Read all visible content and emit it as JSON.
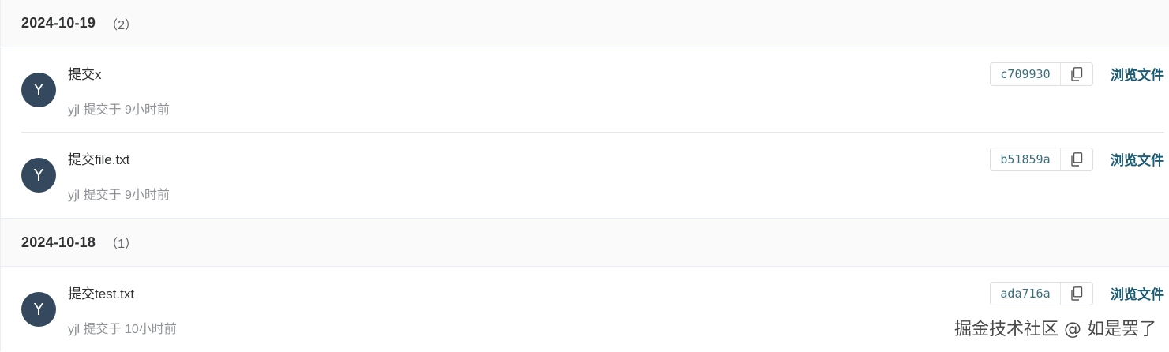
{
  "groups": [
    {
      "date": "2024-10-19",
      "count": "（2）",
      "commits": [
        {
          "avatar": "Y",
          "title": "提交x",
          "meta": "yjl 提交于 9小时前",
          "sha": "c709930",
          "browse": "浏览文件"
        },
        {
          "avatar": "Y",
          "title": "提交file.txt",
          "meta": "yjl 提交于 9小时前",
          "sha": "b51859a",
          "browse": "浏览文件"
        }
      ]
    },
    {
      "date": "2024-10-18",
      "count": "（1）",
      "commits": [
        {
          "avatar": "Y",
          "title": "提交test.txt",
          "meta": "yjl 提交于 10小时前",
          "sha": "ada716a",
          "browse": "浏览文件"
        }
      ]
    }
  ],
  "watermark": "掘金技术社区 @ 如是罢了",
  "icons": {
    "copy": "copy-icon"
  },
  "colors": {
    "avatar_bg": "#34495e",
    "link": "#1b5c74",
    "sha_text": "#3c6e7e"
  }
}
